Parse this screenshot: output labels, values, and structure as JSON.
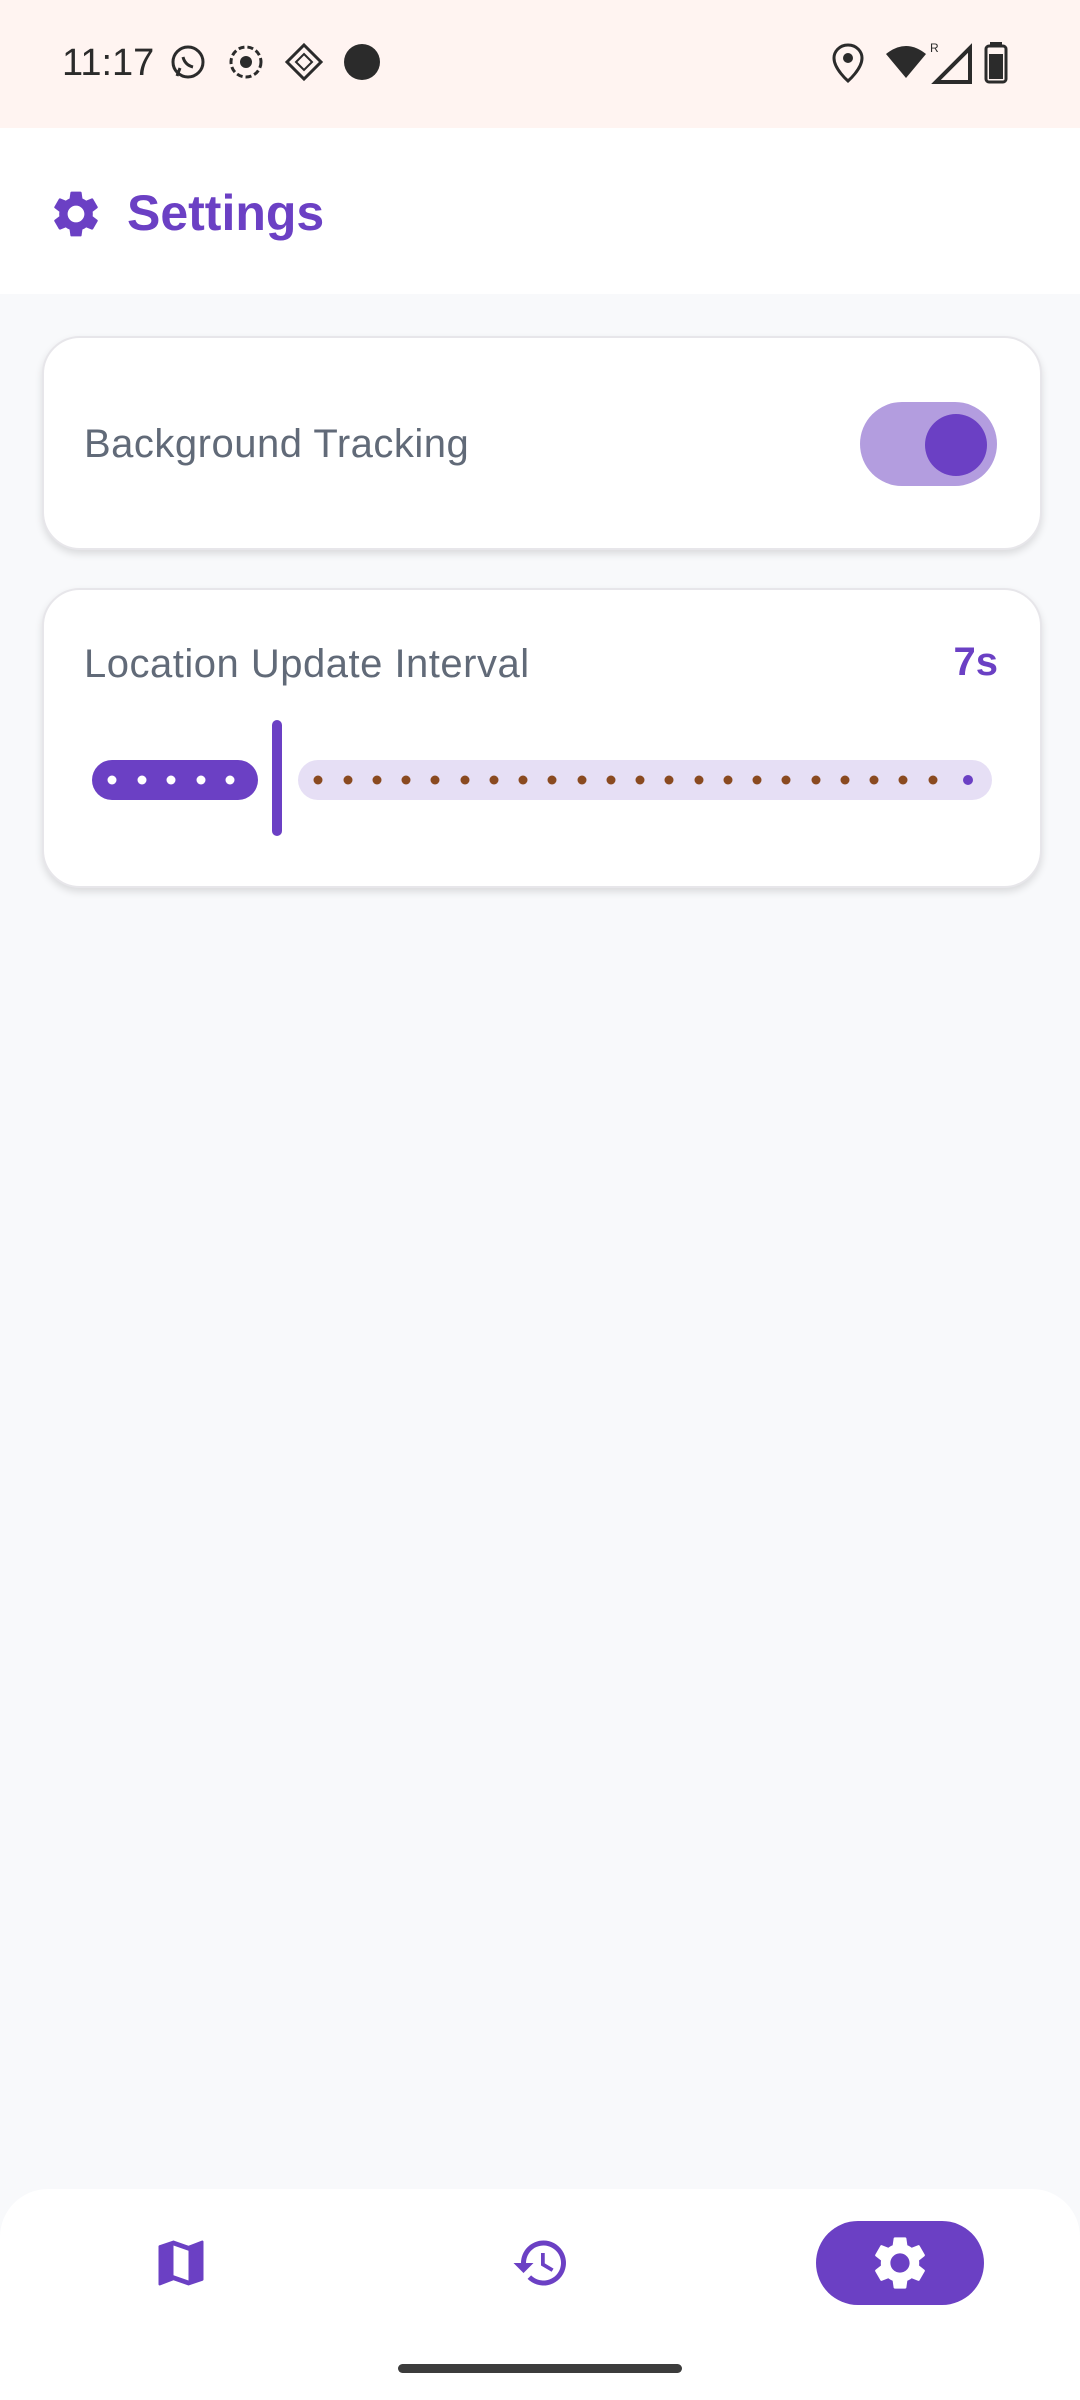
{
  "status_bar": {
    "time": "11:17"
  },
  "header": {
    "title": "Settings",
    "icon": "gear-icon"
  },
  "settings": {
    "background_tracking": {
      "label": "Background Tracking",
      "enabled": true
    },
    "location_update_interval": {
      "label": "Location Update Interval",
      "value_text": "7s",
      "slider_value_fraction": 0.2
    }
  },
  "bottom_nav": {
    "items": [
      {
        "icon": "map-icon",
        "active": false
      },
      {
        "icon": "history-icon",
        "active": false
      },
      {
        "icon": "gear-icon",
        "active": true
      }
    ]
  },
  "colors": {
    "accent": "#6b40c4",
    "track_light": "#e6dff5",
    "toggle_track": "#b39ddf",
    "tick_dots": "#8a4a20"
  }
}
